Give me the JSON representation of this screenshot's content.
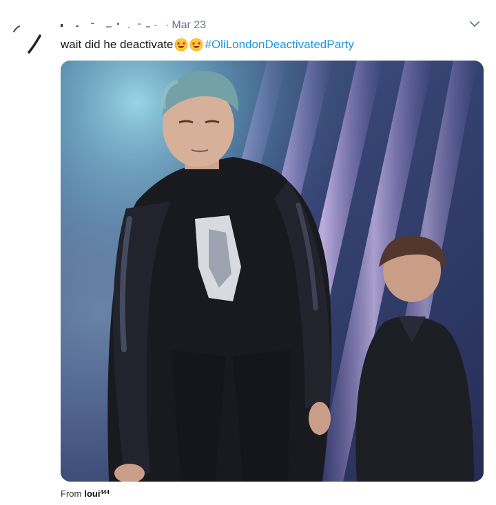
{
  "tweet": {
    "date_separator": "·",
    "date": "Mar 23",
    "text": "wait did he deactivate",
    "emojis": [
      "star-struck-emoji",
      "star-struck-emoji"
    ],
    "hashtag": "#OliLondonDeactivatedParty",
    "menu_icon": "chevron-down-icon"
  },
  "credit": {
    "prefix": "From",
    "username": "loui",
    "superscript": "444"
  },
  "colors": {
    "text": "#14171a",
    "muted": "#657786",
    "link": "#1b95e0"
  }
}
